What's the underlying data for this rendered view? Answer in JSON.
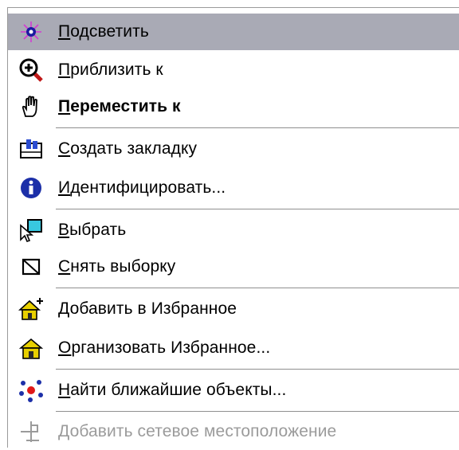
{
  "menu": {
    "items": [
      {
        "label": "Подсветить",
        "icon": "sparkle-icon",
        "state": "highlighted"
      },
      {
        "label": "Приблизить к",
        "icon": "zoom-in-icon"
      },
      {
        "label": "Переместить к",
        "icon": "pan-hand-icon",
        "style": "bold"
      },
      {
        "label": "Создать закладку",
        "icon": "bookmark-icon"
      },
      {
        "label": "Идентифицировать...",
        "icon": "info-icon"
      },
      {
        "label": "Выбрать",
        "icon": "select-features-icon"
      },
      {
        "label": "Снять выборку",
        "icon": "clear-selection-icon"
      },
      {
        "label": "Добавить в Избранное",
        "icon": "add-favorite-house-icon"
      },
      {
        "label": "Организовать Избранное...",
        "icon": "organize-favorites-house-icon"
      },
      {
        "label": "Найти ближайшие объекты...",
        "icon": "nearby-features-dots-icon"
      },
      {
        "label": "Добавить сетевое местоположение",
        "icon": "network-location-icon",
        "state": "disabled"
      }
    ],
    "colors": {
      "highlight": "#a9aab5",
      "disabled_text": "#9b9b9b",
      "separator": "#8f8f8f"
    }
  }
}
